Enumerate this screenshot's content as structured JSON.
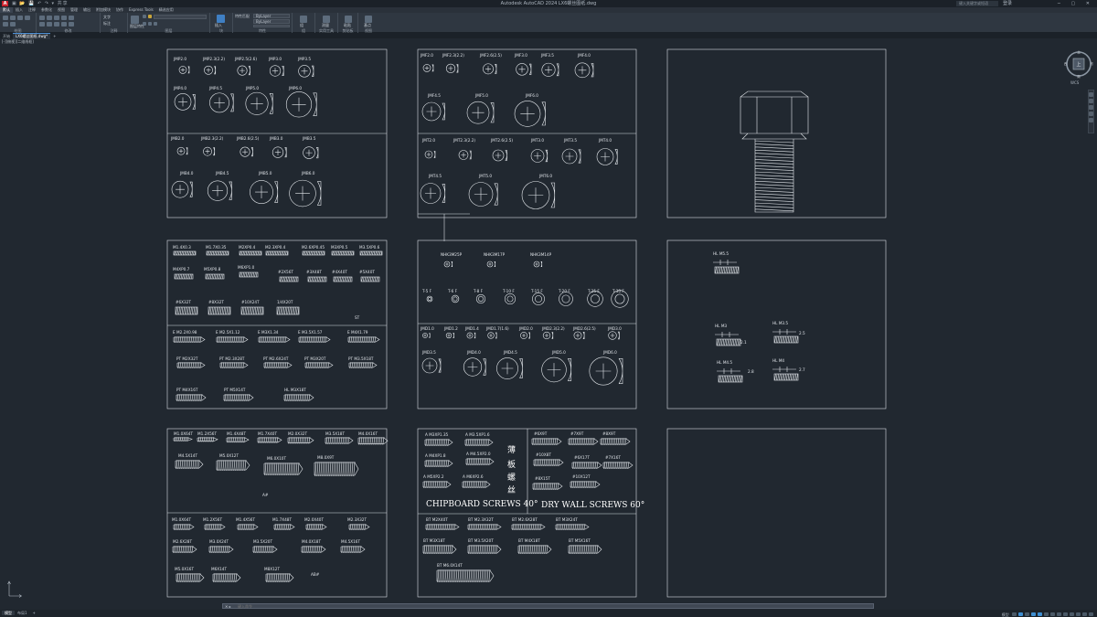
{
  "app": {
    "title": "Autodesk AutoCAD 2024    LX6螺丝图纸.dwg"
  },
  "quick_access": "▣ 📂 💾 ↶ ↷ ▾ 共享",
  "search": {
    "placeholder": "键入关键字或短语"
  },
  "user": "登录",
  "ribbon_tabs": [
    "默认",
    "插入",
    "注释",
    "参数化",
    "视图",
    "管理",
    "输出",
    "附加模块",
    "协作",
    "Express Tools",
    "精选应用"
  ],
  "ribbon_panels": [
    "绘图",
    "修改",
    "注释",
    "图层",
    "块",
    "特性",
    "组",
    "实用工具",
    "剪贴板",
    "视图"
  ],
  "ribbon_labels": {
    "text": "文字",
    "dim": "标注",
    "layer": "图层特性",
    "insert": "插入",
    "match": "特性匹配",
    "group": "组",
    "measure": "测量",
    "paste": "粘贴",
    "base": "基点",
    "bylayer": "ByLayer"
  },
  "doc_tabs": [
    "开始",
    "LX6螺丝图纸.dwg*",
    "+"
  ],
  "viewport_label": "[-][俯视][二维线框]",
  "drawing": {
    "p1_top": [
      "JMP2.0",
      "JMP2.3(2.2)",
      "JMP2.5(2.6)",
      "JMP3.0",
      "JMP3.5",
      "JMP4.0",
      "JMP4.5",
      "JMP5.0",
      "JMP6.0"
    ],
    "p1_bot": [
      "JMB2.0",
      "JMB2.3(2.2)",
      "JMB2.6(2.5)",
      "JMB3.0",
      "JMB3.5",
      "JMB4.0",
      "JMB4.5",
      "JMB5.0",
      "JMB6.0"
    ],
    "p2_top": [
      "JMF2.0",
      "JMF2.3(2.2)",
      "JMF2.6(2.5)",
      "JMF3.0",
      "JMF3.5",
      "JMF4.0",
      "JMF4.5",
      "JMF5.0",
      "JMF6.0"
    ],
    "p2_bot": [
      "JMT2.0",
      "JMT2.3(2.2)",
      "JMT2.6(2.5)",
      "JMT3.0",
      "JMT3.5",
      "JMT4.0",
      "JMT4.5",
      "JMT5.0",
      "JMT6.0"
    ],
    "p4_a": [
      "M1.4X0.3",
      "M1.7X0.35",
      "M2XP0.4",
      "M2.3XP0.4",
      "M2.6XP0.45",
      "M3XP0.5",
      "M3.5XP0.6"
    ],
    "p4_b": [
      "M4XP0.7",
      "M5XP0.8",
      "M6XP1.0",
      "#2X56T",
      "#3X48T",
      "#4X40T",
      "#5X40T"
    ],
    "p4_c": [
      "#6X32T",
      "#8X32T",
      "#10X24T",
      "1/4X20T"
    ],
    "p4_st": "ST",
    "p4_d": [
      "E M2.2X0.98",
      "E M2.5X1.12",
      "E M3X1.34",
      "E M3.5X1.57",
      "E M4X1.79"
    ],
    "p4_e": [
      "PT M2X32T",
      "PT M2.3X28T",
      "PT M2.6X24T",
      "PT M3X20T",
      "PT M3.5X18T"
    ],
    "p4_f": [
      "PT M4X16T",
      "PT M5X14T",
      "HL M3X18T"
    ],
    "p5_a": [
      "NHK3M25P",
      "NHK3M17P",
      "NHK3M14P"
    ],
    "p5_b": [
      "T-5  F",
      "T-6  F",
      "T-8  F",
      "T-10  F",
      "T-15  F",
      "T-20  F",
      "T-25  F",
      "T-30  F"
    ],
    "p5_c": [
      "JMD1.0",
      "JMD1.2",
      "JMD1.4",
      "JMD1.7(1.6)",
      "JMD2.0",
      "JMD2.3(2.2)",
      "JMD2.6(2.5)",
      "JMD3.0"
    ],
    "p5_d": [
      "JMD3.5",
      "JMD4.0",
      "JMD4.5",
      "JMD5.0",
      "JMD6.0"
    ],
    "p6_a": [
      "HL  M5.5",
      "HL  M3",
      "HL  M3.5",
      "HL  M4.5",
      "HL  M4"
    ],
    "p6_dims": [
      "2.1",
      "2.5",
      "2.8",
      "2.7"
    ],
    "p7_a": [
      "M1.0X64T",
      "M1.2X56T",
      "M1.4X48T",
      "M1.7X40T",
      "M2.0X32T",
      "M3.5X18T",
      "M4.0X16T"
    ],
    "p7_b": [
      "M4.5X14T",
      "M5.0X12T",
      "M6.0X10T",
      "M8.0X9T"
    ],
    "p7_a_note": "A#",
    "p7_c": [
      "M1.0X64T",
      "M1.2X56T",
      "M1.4X56T",
      "M1.7X48T",
      "M2.0X40T",
      "M2.3X32T"
    ],
    "p7_d": [
      "M2.6X28T",
      "M3.0X24T",
      "M3.5X20T",
      "M4.0X18T",
      "M4.5X16T"
    ],
    "p7_e": [
      "M5.0X16T",
      "M6X14T",
      "M8X12T"
    ],
    "p7_ab_note": "AB#",
    "p8_a": [
      "A M3XP1.35",
      "A M3.5XP1.6",
      "A M4XP1.8",
      "A M4.5XP2.0",
      "A M5XP2.2",
      "A M6XP2.6"
    ],
    "p8_b": [
      "#6X9T",
      "#7X9T",
      "#8X9T",
      "#10X8T",
      "#6X17T",
      "#7X16T",
      "#8X15T",
      "#10X12T"
    ],
    "p8_cjk": [
      "薄",
      "板",
      "螺",
      "丝"
    ],
    "p8_chip": "CHIPBOARD SCREWS 40°",
    "p8_dry": "DRY WALL SCREWS 60°",
    "p8_c": [
      "BT M2X40T",
      "BT M2.3X32T",
      "BT M2.6X28T",
      "BT M3X24T"
    ],
    "p8_d": [
      "BT M3X18T",
      "BT M3.5X20T",
      "BT M4X18T",
      "BT M5X16T",
      "BT M6.0X14T"
    ]
  },
  "viewcube": {
    "face": "上",
    "n": "北",
    "s": "南",
    "e": "东",
    "w": "西",
    "wcs": "WCS"
  },
  "command": {
    "placeholder": "键入命令",
    "close": "✕ ▸"
  },
  "status_tabs": [
    "模型",
    "布局1",
    "+"
  ],
  "status_model": "模型"
}
